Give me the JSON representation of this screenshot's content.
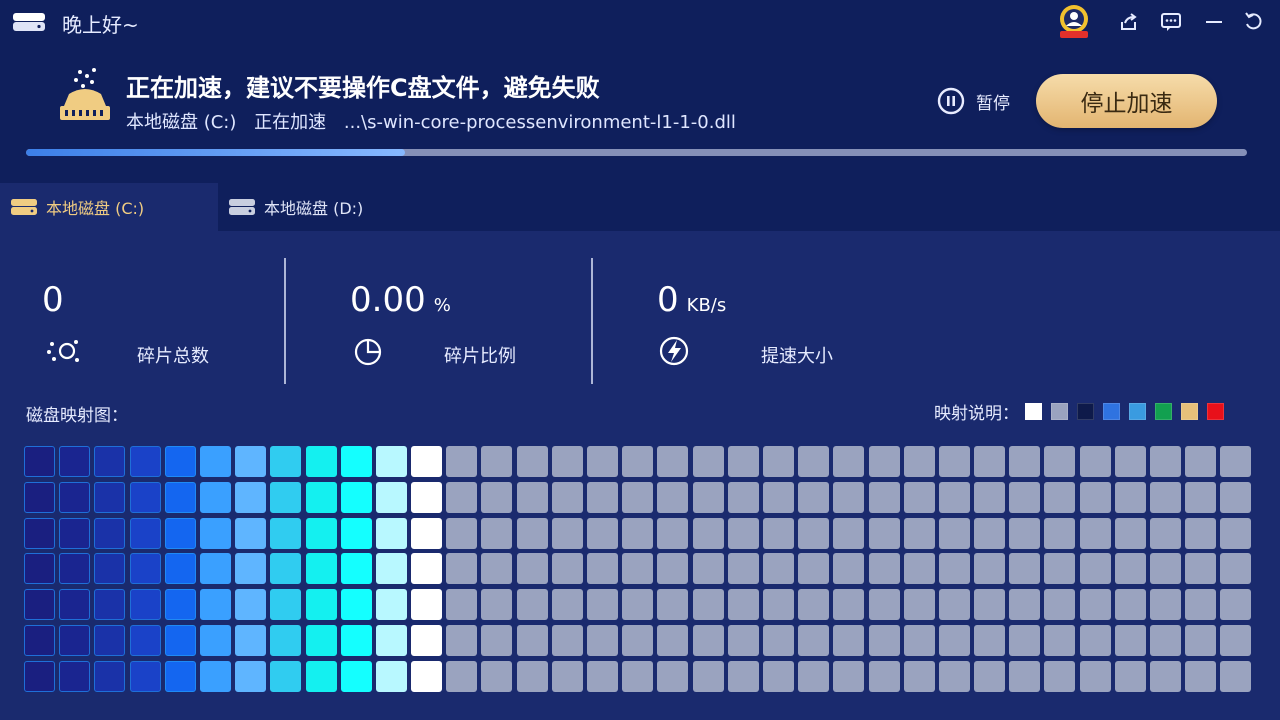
{
  "header": {
    "greeting": "晚上好~",
    "icons": [
      "vip-badge-icon",
      "share-icon",
      "feedback-icon",
      "minimize-icon",
      "back-icon"
    ]
  },
  "status": {
    "title": "正在加速，建议不要操作C盘文件，避免失败",
    "disk": "本地磁盘 (C:)",
    "state": "正在加速",
    "file": "...\\s-win-core-processenvironment-l1-1-0.dll",
    "progress": 0.31,
    "pause_label": "暂停",
    "stop_label": "停止加速"
  },
  "tabs": [
    {
      "label": "本地磁盘  (C:)",
      "active": true
    },
    {
      "label": "本地磁盘  (D:)",
      "active": false
    }
  ],
  "stats": {
    "fragments": {
      "value": "0",
      "label": "碎片总数"
    },
    "ratio": {
      "value": "0.00",
      "unit": "%",
      "label": "碎片比例"
    },
    "speed": {
      "value": "0",
      "unit": "KB/s",
      "label": "提速大小"
    }
  },
  "map": {
    "title": "磁盘映射图：",
    "legend_label": "映射说明：",
    "legend_colors": [
      "#ffffff",
      "#9aa3bf",
      "#0e1a4a",
      "#2f73e0",
      "#3a9be0",
      "#12a050",
      "#e7c07a",
      "#e8101a"
    ],
    "rows": 7,
    "cols": 35,
    "column_colors": [
      "#1a1f80",
      "#1a2590",
      "#1a32a8",
      "#1a42c8",
      "#1466f0",
      "#3aa0ff",
      "#5fb5ff",
      "#30ccf0",
      "#14f0f0",
      "#14ffff",
      "#b8f8ff",
      "#ffffff"
    ],
    "column_borders": [
      "#1f6fd8",
      "#1f6fd8",
      "#1f6fd8",
      "#1f6fd8",
      "#1f8af5",
      "#3aa0ff",
      "#5fb5ff",
      "#30ccf0",
      "#14f0f0",
      "#14ffff",
      "#b8f8ff",
      "#ffffff"
    ],
    "default_color": "#9aa3bf"
  }
}
